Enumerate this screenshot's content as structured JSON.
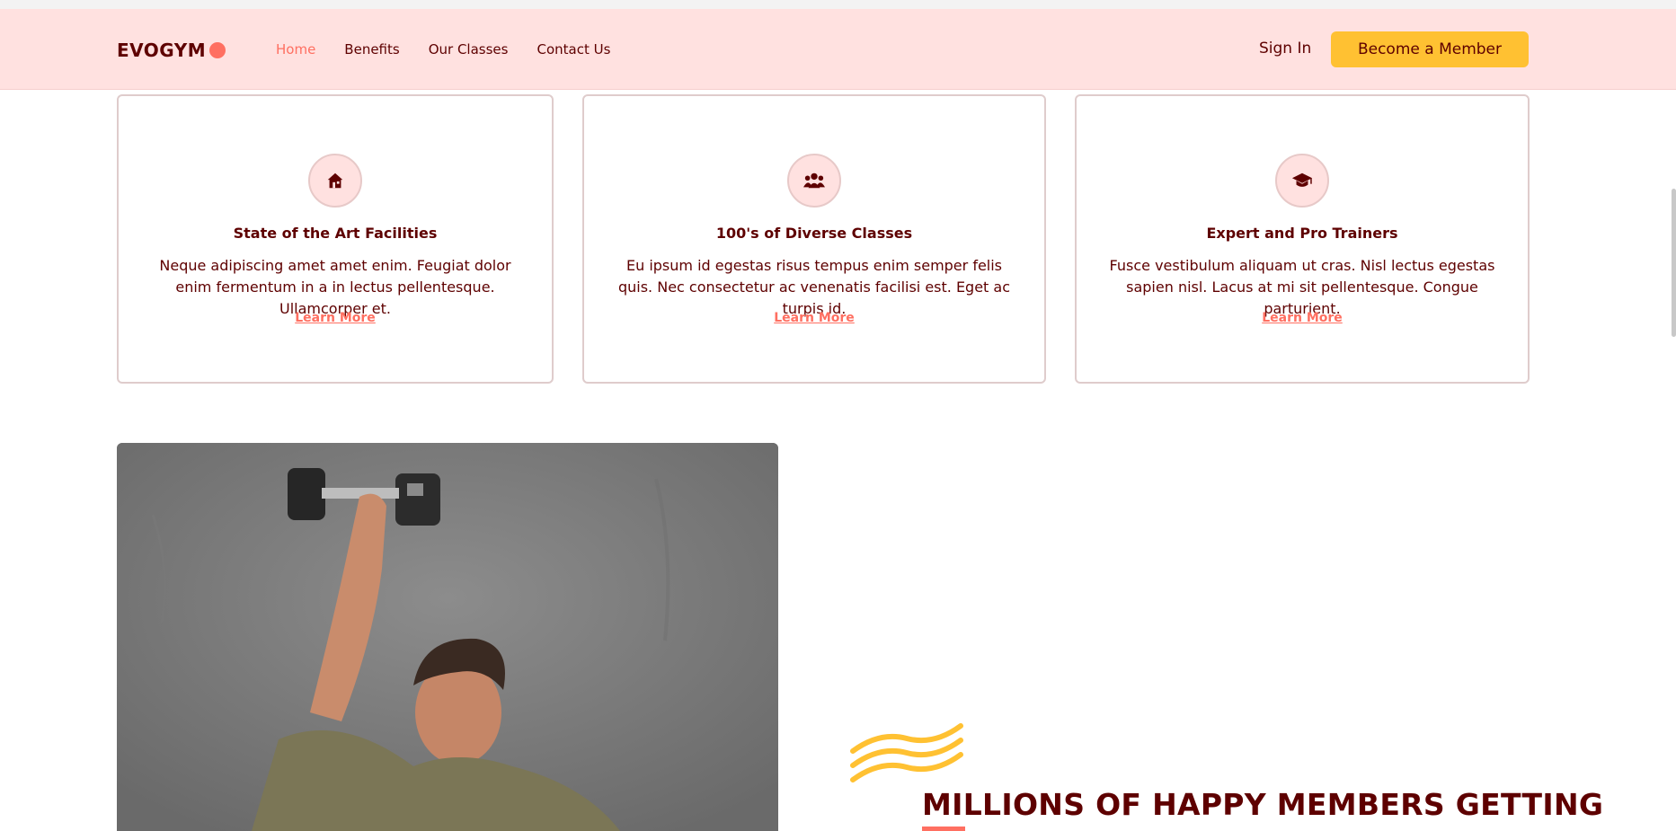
{
  "navbar": {
    "logo": "EVOGYM",
    "links": [
      "Home",
      "Benefits",
      "Our Classes",
      "Contact Us"
    ],
    "active": "Home",
    "sign_in": "Sign In",
    "cta": "Become a Member"
  },
  "benefits": [
    {
      "icon": "home-icon",
      "title": "State of the Art Facilities",
      "text": "Neque adipiscing amet amet enim. Feugiat dolor enim fermentum in a in lectus pellentesque. Ullamcorper et.",
      "link": "Learn More"
    },
    {
      "icon": "user-group-icon",
      "title": "100's of Diverse Classes",
      "text": "Eu ipsum id egestas risus tempus enim semper felis quis. Nec consectetur ac venenatis facilisi est. Eget ac turpis id.",
      "link": "Learn More"
    },
    {
      "icon": "graduation-cap-icon",
      "title": "Expert and Pro Trainers",
      "text": "Fusce vestibulum aliquam ut cras. Nisl lectus egestas sapien nisl. Lacus at mi sit pellentesque. Congue parturient.",
      "link": "Learn More"
    }
  ],
  "section": {
    "heading": "MILLIONS OF HAPPY MEMBERS GETTING"
  },
  "colors": {
    "primary": "#5e0000",
    "accent": "#ff6f61",
    "nav_bg": "#ffe1e0",
    "cta": "#ffc132"
  }
}
